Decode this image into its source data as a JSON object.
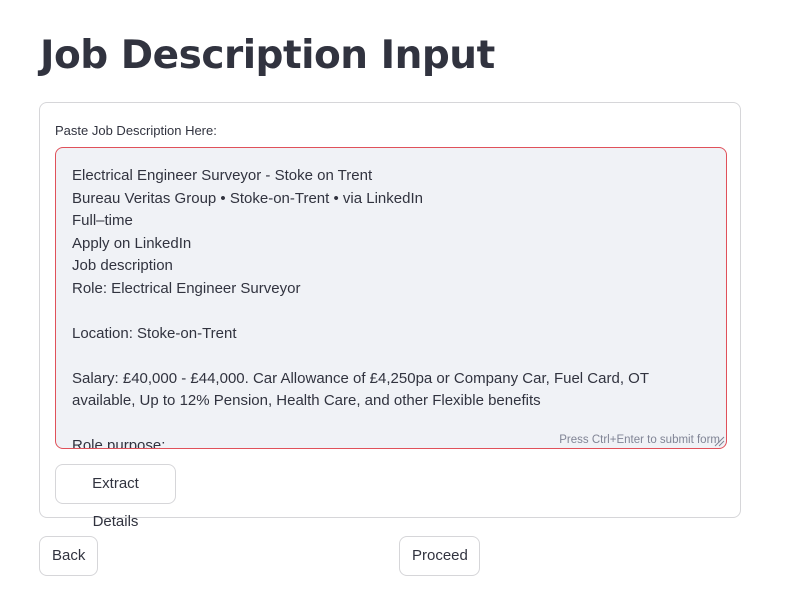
{
  "page": {
    "title": "Job Description Input"
  },
  "form": {
    "label": "Paste Job Description Here:",
    "textarea_value": "Electrical Engineer Surveyor - Stoke on Trent\nBureau Veritas Group • Stoke-on-Trent • via LinkedIn\nFull–time\nApply on LinkedIn\nJob description\nRole: Electrical Engineer Surveyor\n\nLocation: Stoke-on-Trent\n\nSalary: £40,000 - £44,000. Car Allowance of £4,250pa or Company Car, Fuel Card, OT available, Up to 12% Pension, Health Care, and other Flexible benefits\n\nRole purpose:",
    "hint": "Press Ctrl+Enter to submit form",
    "extract_label": "Extract Details"
  },
  "nav": {
    "back_label": "Back",
    "proceed_label": "Proceed"
  },
  "colors": {
    "textarea_border": "#e0515a",
    "textarea_bg": "#f0f2f6",
    "text": "#31333f"
  }
}
